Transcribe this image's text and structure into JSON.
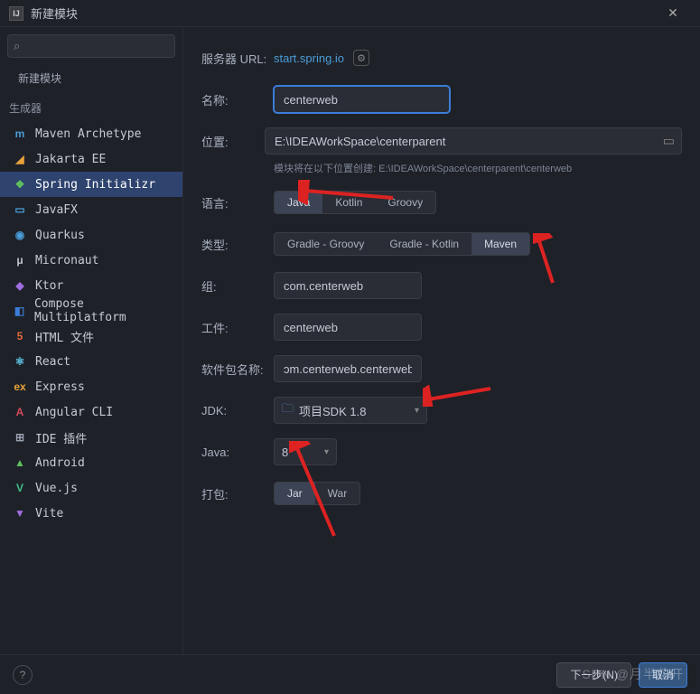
{
  "title": "新建模块",
  "search_placeholder": "",
  "tree_header": "新建模块",
  "section_label": "生成器",
  "generators": [
    {
      "id": "maven-archetype",
      "label": "Maven Archetype",
      "icon_text": "m",
      "icon_color": "#4a9dd8",
      "selected": false
    },
    {
      "id": "jakarta-ee",
      "label": "Jakarta EE",
      "icon_text": "◢",
      "icon_color": "#e8a23b",
      "selected": false
    },
    {
      "id": "spring-initializr",
      "label": "Spring Initializr",
      "icon_text": "❖",
      "icon_color": "#5fbf5f",
      "selected": true
    },
    {
      "id": "javafx",
      "label": "JavaFX",
      "icon_text": "▭",
      "icon_color": "#4a9dd8",
      "selected": false
    },
    {
      "id": "quarkus",
      "label": "Quarkus",
      "icon_text": "◉",
      "icon_color": "#4a9dd8",
      "selected": false
    },
    {
      "id": "micronaut",
      "label": "Micronaut",
      "icon_text": "μ",
      "icon_color": "#bfc5d0",
      "selected": false
    },
    {
      "id": "ktor",
      "label": "Ktor",
      "icon_text": "◆",
      "icon_color": "#a06de0",
      "selected": false
    },
    {
      "id": "compose-mp",
      "label": "Compose Multiplatform",
      "icon_text": "◧",
      "icon_color": "#3b7dd8",
      "selected": false
    },
    {
      "id": "html",
      "label": "HTML 文件",
      "icon_text": "5",
      "icon_color": "#e06a3b",
      "selected": false
    },
    {
      "id": "react",
      "label": "React",
      "icon_text": "⚛",
      "icon_color": "#5fc8ea",
      "selected": false
    },
    {
      "id": "express",
      "label": "Express",
      "icon_text": "ex",
      "icon_color": "#e8a23b",
      "selected": false
    },
    {
      "id": "angular",
      "label": "Angular CLI",
      "icon_text": "A",
      "icon_color": "#d84a5a",
      "selected": false
    },
    {
      "id": "ide-plugin",
      "label": "IDE 插件",
      "icon_text": "⊞",
      "icon_color": "#9aa2b0",
      "selected": false
    },
    {
      "id": "android",
      "label": "Android",
      "icon_text": "▲",
      "icon_color": "#5fbf5f",
      "selected": false
    },
    {
      "id": "vuejs",
      "label": "Vue.js",
      "icon_text": "V",
      "icon_color": "#3fbf8a",
      "selected": false
    },
    {
      "id": "vite",
      "label": "Vite",
      "icon_text": "▼",
      "icon_color": "#a06de0",
      "selected": false
    }
  ],
  "form": {
    "server_url_label": "服务器 URL:",
    "server_url": "start.spring.io",
    "name_label": "名称:",
    "name_value": "centerweb",
    "location_label": "位置:",
    "location_value": "E:\\IDEAWorkSpace\\centerparent",
    "location_hint_prefix": "模块将在以下位置创建: ",
    "location_hint_path": "E:\\IDEAWorkSpace\\centerparent\\centerweb",
    "language_label": "语言:",
    "languages": [
      {
        "label": "Java",
        "selected": true
      },
      {
        "label": "Kotlin",
        "selected": false
      },
      {
        "label": "Groovy",
        "selected": false
      }
    ],
    "type_label": "类型:",
    "types": [
      {
        "label": "Gradle - Groovy",
        "selected": false
      },
      {
        "label": "Gradle - Kotlin",
        "selected": false
      },
      {
        "label": "Maven",
        "selected": true
      }
    ],
    "group_label": "组:",
    "group_value": "com.centerweb",
    "artifact_label": "工件:",
    "artifact_value": "centerweb",
    "package_label": "软件包名称:",
    "package_value": "ɔm.centerweb.centerweb",
    "jdk_label": "JDK:",
    "jdk_value": "项目SDK 1.8",
    "java_label": "Java:",
    "java_value": "8",
    "packaging_label": "打包:",
    "packaging": [
      {
        "label": "Jar",
        "selected": true
      },
      {
        "label": "War",
        "selected": false
      }
    ]
  },
  "footer": {
    "help": "?",
    "next": "下一步(N)",
    "cancel": "取消"
  },
  "watermark": "SDN @月半花开"
}
